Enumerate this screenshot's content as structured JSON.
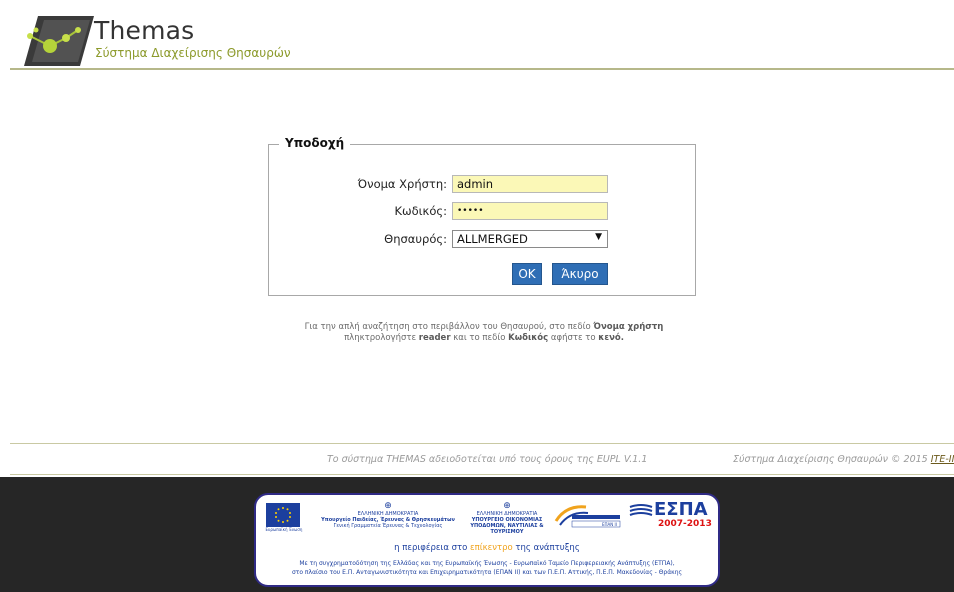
{
  "brand": {
    "title": "Themas",
    "subtitle": "Σύστημα Διαχείρισης Θησαυρών"
  },
  "login": {
    "legend": "Υποδοχή",
    "username_label": "Όνομα Χρήστη:",
    "username_value": "admin",
    "password_label": "Κωδικός:",
    "password_value": "•••••",
    "thesaurus_label": "Θησαυρός:",
    "thesaurus_value": "ALLMERGED",
    "ok_label": "OK",
    "cancel_label": "Άκυρο"
  },
  "hint": {
    "line1_a": "Για την απλή αναζήτηση στο περιβάλλον του Θησαυρού, στο πεδίο ",
    "line1_b": "Όνομα χρήστη",
    "line2_a": "πληκτρολογήστε ",
    "line2_b": "reader",
    "line2_c": " και το πεδίο ",
    "line2_d": "Κωδικός",
    "line2_e": " αφήστε το ",
    "line2_f": "κενό."
  },
  "footer": {
    "license": "Το σύστημα THEMAS αδειοδοτείται υπό τους όρους της EUPL V.1.1",
    "copyright_text": "Σύστημα Διαχείρισης Θησαυρών © 2015 ",
    "copyright_link": "ΙΤΕ-ΙΠ ΚΠΙ"
  },
  "sponsor": {
    "eu_caption": "Ευρωπαϊκή Ένωση",
    "min1_a": "ΕΛΛΗΝΙΚΗ ΔΗΜΟΚΡΑΤΙΑ",
    "min1_b": "Υπουργείο Παιδείας, Έρευνας & Θρησκευμάτων",
    "min1_c": "Γενική Γραμματεία Έρευνας & Τεχνολογίας",
    "min2_a": "ΕΛΛΗΝΙΚΗ ΔΗΜΟΚΡΑΤΙΑ",
    "min2_b": "ΥΠΟΥΡΓΕΙΟ ΟΙΚΟΝΟΜΙΑΣ",
    "min2_c": "ΥΠΟΔΟΜΩΝ, ΝΑΥΤΙΛΙΑΣ & ΤΟΥΡΙΣΜΟΥ",
    "epan": "ΕΠΑΝ II",
    "espa_title": "ΕΣΠΑ",
    "espa_years": "2007-2013",
    "tagline_a": "η περιφέρεια στο ",
    "tagline_b": "επίκεντρο",
    "tagline_c": " της ανάπτυξης",
    "fund_1": "Με τη συγχρηματοδότηση της Ελλάδας και της Ευρωπαϊκής Ένωσης - Ευρωπαϊκό Ταμείο Περιφερειακής Ανάπτυξης (ΕΤΠΑ),",
    "fund_2": "στο πλαίσιο του Ε.Π. Ανταγωνιστικότητα και Επιχειρηματικότητα (ΕΠΑΝ ΙΙ) και των Π.Ε.Π. Αττικής, Π.Ε.Π. Μακεδονίας - Θράκης"
  }
}
